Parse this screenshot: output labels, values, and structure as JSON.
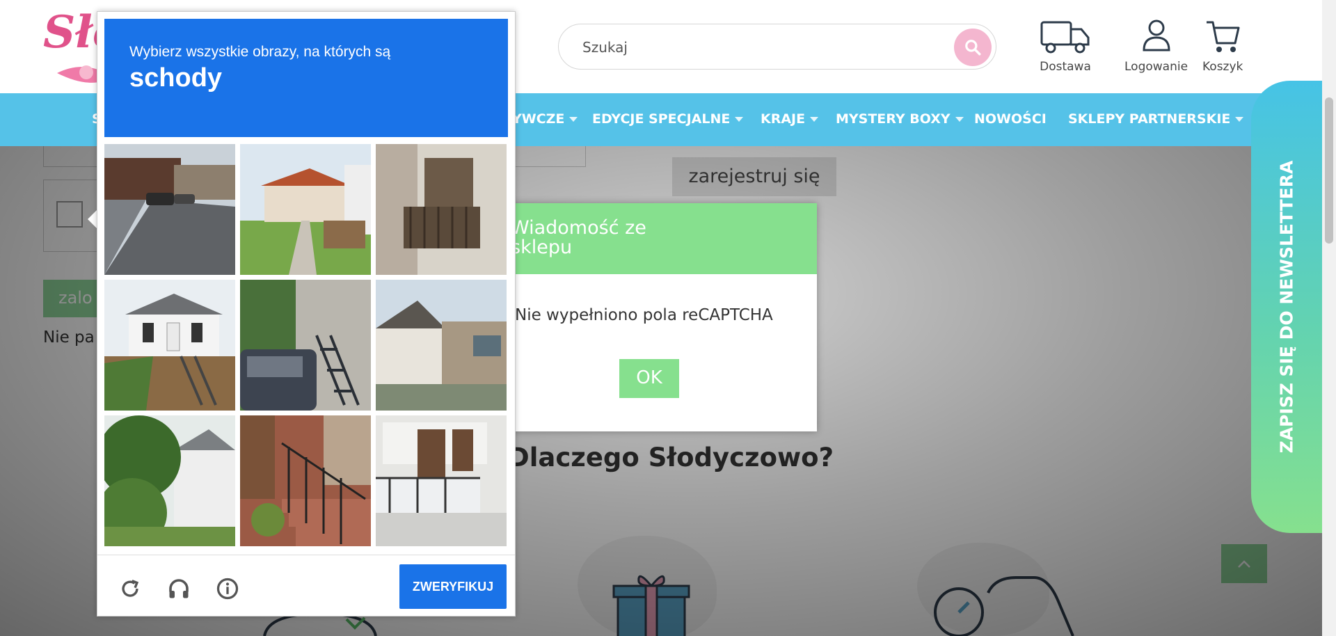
{
  "header": {
    "logo_text": "Słodyczowo",
    "search": {
      "placeholder": "Szukaj"
    },
    "links": [
      {
        "label": "Dostawa",
        "icon": "truck-icon"
      },
      {
        "label": "Logowanie",
        "icon": "user-icon"
      },
      {
        "label": "Koszyk",
        "icon": "cart-icon"
      }
    ]
  },
  "nav": {
    "items": [
      {
        "label": "S",
        "has_dropdown": false
      },
      {
        "label": "YWCZE",
        "has_dropdown": true
      },
      {
        "label": "EDYCJE SPECJALNE",
        "has_dropdown": true
      },
      {
        "label": "KRAJE",
        "has_dropdown": true
      },
      {
        "label": "MYSTERY BOXY",
        "has_dropdown": true
      },
      {
        "label": "NOWOŚCI",
        "has_dropdown": false
      },
      {
        "label": "SKLEPY PARTNERSKIE",
        "has_dropdown": true
      }
    ],
    "color": "#55c2e8"
  },
  "page": {
    "login_button": "zalo",
    "forgot_text": "Nie pa",
    "register_button": "zarejestruj się",
    "why_heading": "Dlaczego Słodyczowo?"
  },
  "newsletter_tab": "ZAPISZ SIĘ DO NEWSLETTERA",
  "shop_message": {
    "title_line1": "Wiadomość ze",
    "title_line2": "sklepu",
    "body": "Nie wypełniono pola reCAPTCHA",
    "ok_button": "OK",
    "accent": "#86e08e"
  },
  "recaptcha": {
    "instruction": "Wybierz wszystkie obrazy, na których są",
    "target": "schody",
    "verify_button": "ZWERYFIKUJ",
    "tools": [
      "reload-icon",
      "headphones-icon",
      "info-icon"
    ],
    "tiles": [
      "street-with-cars",
      "house-with-red-roof",
      "building-balcony",
      "white-house-with-stairs",
      "car-and-stairs-ivy",
      "house-with-balcony",
      "house-behind-trees",
      "brick-steps-with-railing",
      "white-building-balconies"
    ],
    "accent": "#1a73e8"
  }
}
